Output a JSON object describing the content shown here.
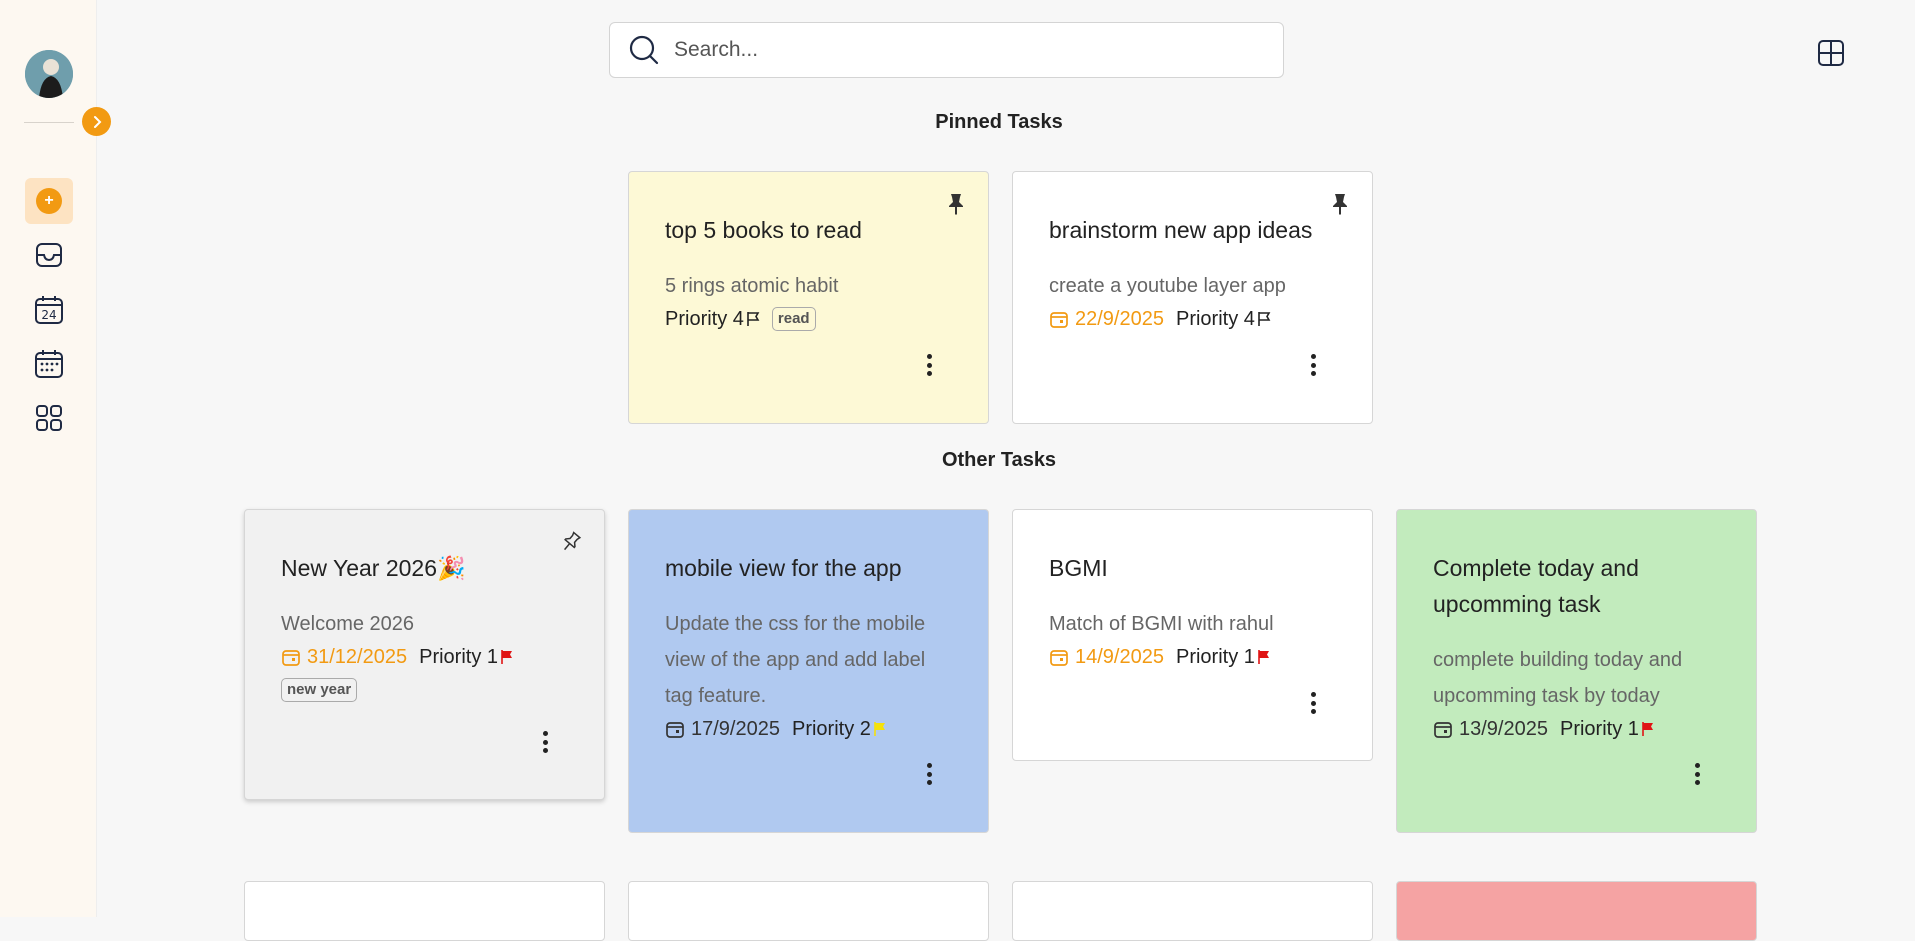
{
  "search": {
    "placeholder": "Search..."
  },
  "sections": {
    "pinned": "Pinned Tasks",
    "other": "Other Tasks"
  },
  "nav": {
    "calendar_day": "24",
    "items": [
      "add-task",
      "inbox",
      "today",
      "upcoming",
      "categories"
    ]
  },
  "colors": {
    "accent": "#f29a12",
    "yellow_card": "#fdf9d6",
    "blue_card": "#b0c9f0",
    "green_card": "#c2ebbd",
    "gray_card": "#f1f1f1",
    "red_card": "#f5a3a3",
    "priority1_flag": "#e01414",
    "priority2_flag": "#f5e10a"
  },
  "pinned_tasks": [
    {
      "title": "top 5 books to read",
      "description": "5 rings atomic habit",
      "priority": "Priority 4",
      "tag": "read"
    },
    {
      "title": "brainstorm new app ideas",
      "description": "create a youtube layer app",
      "date": "22/9/2025",
      "priority": "Priority 4"
    }
  ],
  "other_tasks": [
    {
      "title": "New Year 2026",
      "title_emoji": "🎉",
      "description": "Welcome 2026",
      "date": "31/12/2025",
      "priority": "Priority 1",
      "tag": "new year"
    },
    {
      "title": "mobile view for the app",
      "description": "Update the css for the mobile view of the app and add label tag feature.",
      "date": "17/9/2025",
      "priority": "Priority 2"
    },
    {
      "title": "BGMI",
      "description": "Match of BGMI with rahul",
      "date": "14/9/2025",
      "priority": "Priority 1"
    },
    {
      "title": "Complete today and upcomming task",
      "description": "complete building today and upcomming task by today",
      "date": "13/9/2025",
      "priority": "Priority 1"
    }
  ]
}
